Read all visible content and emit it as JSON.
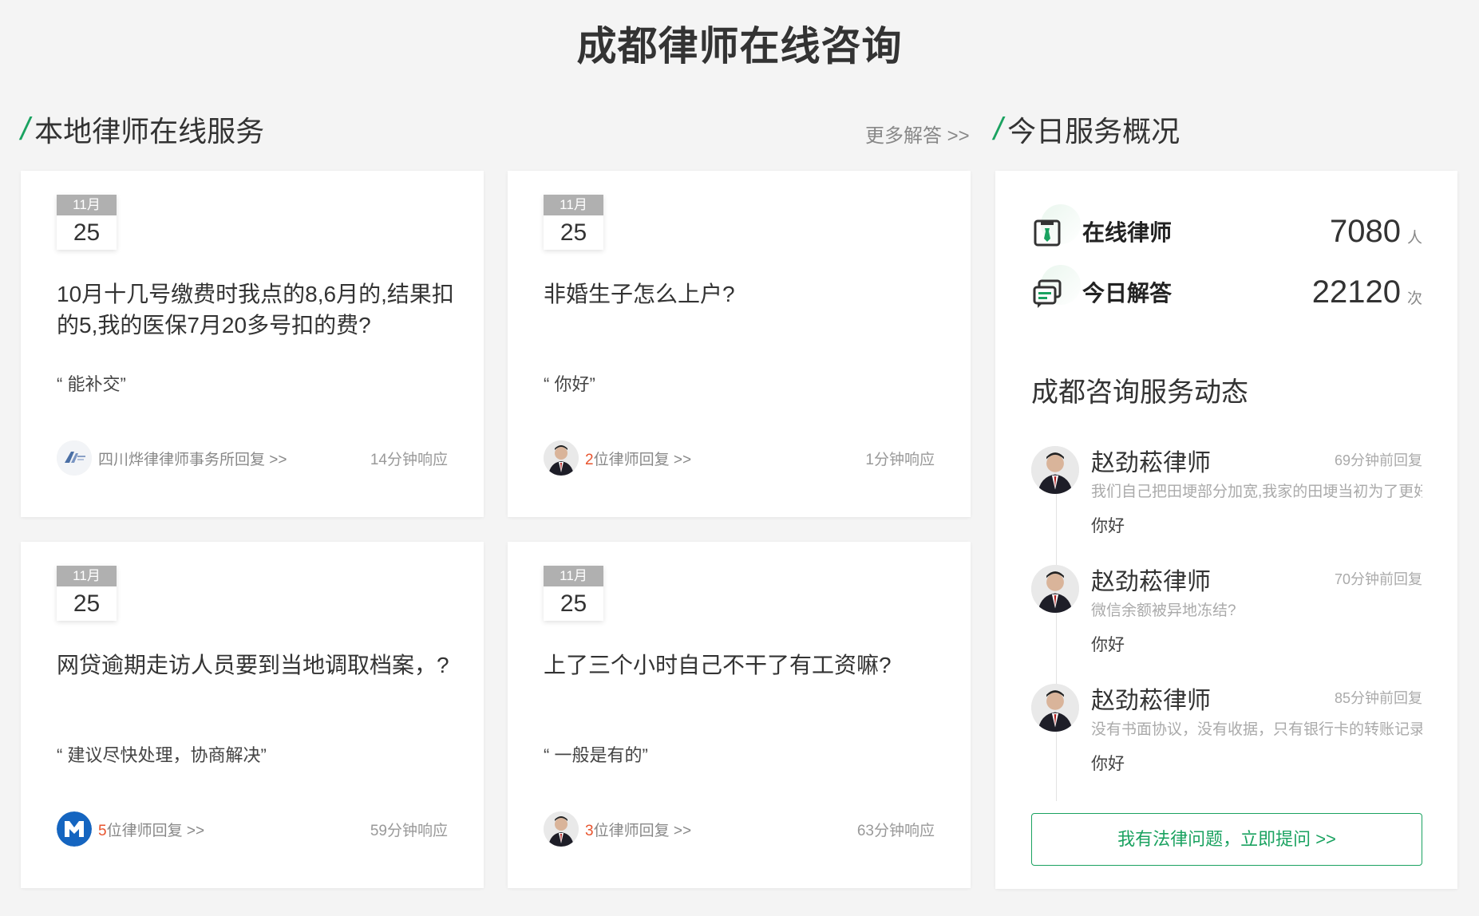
{
  "page": {
    "title": "成都律师在线咨询"
  },
  "sections": {
    "local_service": {
      "title": "本地律师在线服务",
      "more_label": "更多解答 >>"
    },
    "overview": {
      "title": "今日服务概况"
    }
  },
  "cards": [
    {
      "month": "11月",
      "day": "25",
      "question": "10月十几号缴费时我点的8,6月的,结果扣的5,我的医保7月20多号扣的费?",
      "answer": "“ 能补交”",
      "reply_count": "",
      "reply_text": "四川烨律律师事务所回复 >>",
      "response_time": "14分钟响应",
      "avatar": "firm-logo"
    },
    {
      "month": "11月",
      "day": "25",
      "question": "非婚生子怎么上户?",
      "answer": "“ 你好”",
      "reply_count": "2",
      "reply_text": "位律师回复 >>",
      "response_time": "1分钟响应",
      "avatar": "lawyer-photo"
    },
    {
      "month": "11月",
      "day": "25",
      "question": "网贷逾期走访人员要到当地调取档案，?",
      "answer": "“ 建议尽快处理，协商解决”",
      "reply_count": "5",
      "reply_text": "位律师回复 >>",
      "response_time": "59分钟响应",
      "avatar": "firm-logo-blue"
    },
    {
      "month": "11月",
      "day": "25",
      "question": "上了三个小时自己不干了有工资嘛?",
      "answer": "“ 一般是有的”",
      "reply_count": "3",
      "reply_text": "位律师回复 >>",
      "response_time": "63分钟响应",
      "avatar": "lawyer-photo"
    }
  ],
  "stats": [
    {
      "label": "在线律师",
      "value": "7080",
      "unit": "人",
      "icon": "lawyer-badge-icon"
    },
    {
      "label": "今日解答",
      "value": "22120",
      "unit": "次",
      "icon": "chat-bubbles-icon"
    }
  ],
  "feed": {
    "title": "成都咨询服务动态",
    "items": [
      {
        "name": "赵劲菘律师",
        "time": "69分钟前回复",
        "question": "我们自己把田埂部分加宽,我家的田埂当初为了更好",
        "reply": "你好"
      },
      {
        "name": "赵劲菘律师",
        "time": "70分钟前回复",
        "question": "微信余额被异地冻结?",
        "reply": "你好"
      },
      {
        "name": "赵劲菘律师",
        "time": "85分钟前回复",
        "question": "没有书面协议，没有收据，只有银行卡的转账记录，",
        "reply": "你好"
      }
    ]
  },
  "ask_button": {
    "label": "我有法律问题，立即提问 >>"
  },
  "colors": {
    "accent": "#1aa260",
    "highlight": "#e8542e"
  }
}
